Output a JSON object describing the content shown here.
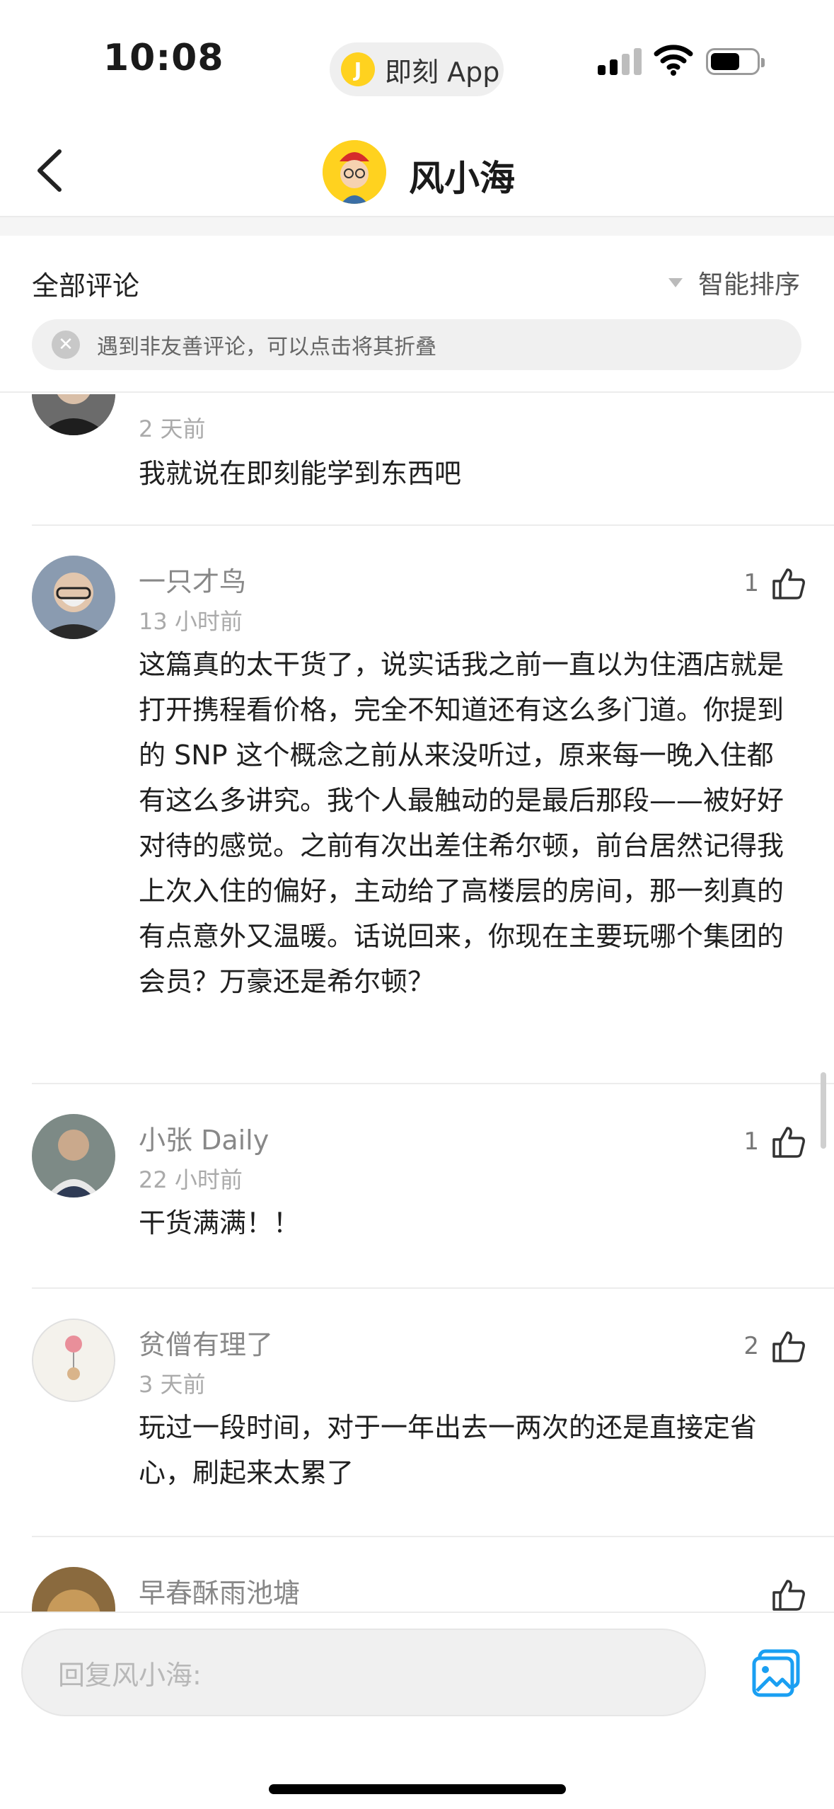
{
  "status_bar": {
    "time": "10:08",
    "app_name": "即刻 App",
    "app_logo_letter": "J"
  },
  "header": {
    "title": "风小海",
    "back_icon": "chevron-left-icon"
  },
  "comments_header": {
    "title": "全部评论",
    "sort_label": "智能排序",
    "tip_text": "遇到非友善评论，可以点击将其折叠"
  },
  "comments": [
    {
      "name": "",
      "time": "2 天前",
      "text": "我就说在即刻能学到东西吧",
      "likes": ""
    },
    {
      "name": "一只才鸟",
      "time": "13 小时前",
      "text": "这篇真的太干货了，说实话我之前一直以为住酒店就是打开携程看价格，完全不知道还有这么多门道。你提到的 SNP 这个概念之前从来没听过，原来每一晚入住都有这么多讲究。我个人最触动的是最后那段——被好好对待的感觉。之前有次出差住希尔顿，前台居然记得我上次入住的偏好，主动给了高楼层的房间，那一刻真的有点意外又温暖。话说回来，你现在主要玩哪个集团的会员？万豪还是希尔顿？",
      "likes": "1"
    },
    {
      "name": "小张 Daily",
      "time": "22 小时前",
      "text": "干货满满！！",
      "likes": "1"
    },
    {
      "name": "贫僧有理了",
      "time": "3 天前",
      "text": "玩过一段时间，对于一年出去一两次的还是直接定省心，刷起来太累了",
      "likes": "2"
    },
    {
      "name": "早春酥雨池塘",
      "time": "",
      "text": "",
      "likes": ""
    }
  ],
  "reply_bar": {
    "placeholder": "回复风小海:",
    "image_icon": "image-picker-icon"
  },
  "colors": {
    "brand_yellow": "#ffd21f",
    "accent_blue": "#1a9ff2",
    "muted_text": "#888888"
  }
}
